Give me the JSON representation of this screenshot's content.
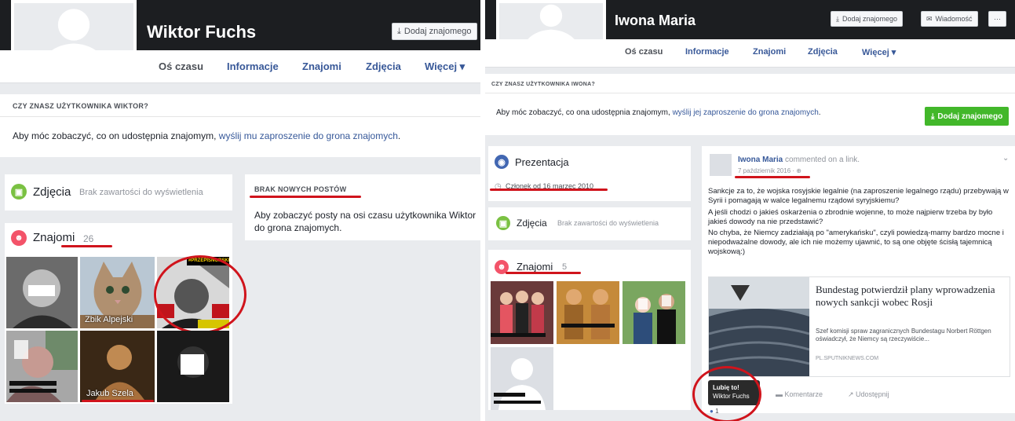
{
  "left": {
    "profile_name": "Wiktor Fuchs",
    "add_friend_label": "Dodaj znajomego",
    "tabs": [
      {
        "label": "Oś czasu"
      },
      {
        "label": "Informacje"
      },
      {
        "label": "Znajomi"
      },
      {
        "label": "Zdjęcia"
      },
      {
        "label": "Więcej ▾"
      }
    ],
    "know_heading": "CZY ZNASZ UŻYTKOWNIKA WIKTOR?",
    "know_text_prefix": "Aby móc zobaczyć, co on udostępnia znajomym, ",
    "know_link": "wyślij mu zaproszenie do grona znajomych",
    "know_text_suffix": ".",
    "photos_title": "Zdjęcia",
    "photos_empty": "Brak zawartości do wyświetlenia",
    "friends_title": "Znajomi",
    "friends_count": "26",
    "no_posts_heading": "BRAK NOWYCH POSTÓW",
    "no_posts_text": "Aby zobaczyć posty na osi czasu użytkownika Wiktor do grona znajomych.",
    "friend_tiles": [
      {
        "caption": ""
      },
      {
        "caption": "Zbik Alpejski"
      },
      {
        "caption": "#PRZEPISNORSKI"
      },
      {
        "caption": ""
      },
      {
        "caption": "Jakub Szela"
      },
      {
        "caption": ""
      }
    ]
  },
  "right": {
    "profile_name": "Iwona Maria",
    "add_friend_label": "Dodaj znajomego",
    "message_label": "Wiadomość",
    "more_label": "···",
    "tabs": [
      {
        "label": "Oś czasu"
      },
      {
        "label": "Informacje"
      },
      {
        "label": "Znajomi"
      },
      {
        "label": "Zdjęcia"
      },
      {
        "label": "Więcej ▾"
      }
    ],
    "know_heading": "CZY ZNASZ UŻYTKOWNIKA IWONA?",
    "know_text_prefix": "Aby móc zobaczyć, co ona udostępnia znajomym, ",
    "know_link": "wyślij jej zaproszenie do grona znajomych",
    "know_text_suffix": ".",
    "add_friend_green": "Dodaj znajomego",
    "intro_title": "Prezentacja",
    "member_since": "Członek od 16 marzec 2010",
    "photos_title": "Zdjęcia",
    "photos_empty": "Brak zawartości do wyświetlenia",
    "friends_title": "Znajomi",
    "friends_count": "5",
    "post": {
      "author": "Iwona Maria",
      "action": "commented on a link.",
      "date": "7 październik 2016 · ⊕",
      "paragraph1": "Sankcje za to, że wojska rosyjskie legalnie (na zaproszenie legalnego rządu) przebywają w Syrii i pomagają w walce legalnemu rządowi syryjskiemu?",
      "paragraph2": "A jeśli chodzi o jakieś oskarżenia o zbrodnie wojenne, to może najpierw trzeba by było jakieś dowody na nie przedstawić?",
      "paragraph3": "No chyba, że Niemcy zadziałają po \"amerykańsku\", czyli powiedzą-mamy bardzo mocne i niepodważalne dowody, ale ich nie możemy ujawnić, to są one objęte ścisłą tajemnicą wojskową:)",
      "link_title": "Bundestag potwierdził plany wprowadzenia nowych sankcji wobec Rosji",
      "link_desc": "Szef komisji spraw zagranicznych Bundestagu Norbert Röttgen oświadczył, że Niemcy są rzeczywiście...",
      "link_domain": "PL.SPUTNIKNEWS.COM",
      "like_tooltip_title": "Lubię to!",
      "like_tooltip_name": "Wiktor Fuchs",
      "comment_label": "Komentarze",
      "share_label": "Udostępnij",
      "like_count": "1"
    }
  }
}
